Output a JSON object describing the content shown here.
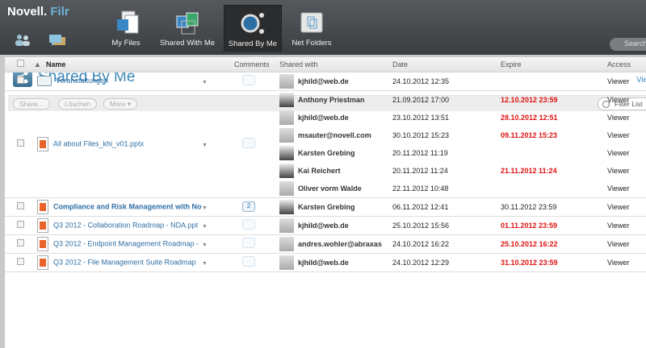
{
  "app": {
    "brand": "Novell.",
    "product": "Filr",
    "search_placeholder": "Search"
  },
  "nav": [
    {
      "label": "My Files",
      "icon": "my-files-icon"
    },
    {
      "label": "Shared With Me",
      "icon": "shared-with-me-icon"
    },
    {
      "label": "Shared By Me",
      "icon": "shared-by-me-icon",
      "active": true
    },
    {
      "label": "Net Folders",
      "icon": "net-folders-icon"
    }
  ],
  "page": {
    "title": "Shared By Me",
    "view_link": "Vie"
  },
  "toolbar": {
    "share": "Share...",
    "delete": "Löschen",
    "more": "More ▾",
    "filter": "Filter List"
  },
  "columns": {
    "name": "Name",
    "comments": "Comments",
    "shared_with": "Shared with",
    "date": "Date",
    "expire": "Expire",
    "access": "Access"
  },
  "rows": [
    {
      "name": "Veranstaltungen",
      "type": "folder",
      "comments": "",
      "shares": [
        {
          "who": "kjhild@web.de",
          "date": "24.10.2012 12:35",
          "expire": "",
          "expired": false,
          "access": "Viewer"
        }
      ]
    },
    {
      "name": "All about Files_khi_v01.pptx",
      "type": "pptx",
      "comments": "",
      "shares": [
        {
          "who": "Anthony Priestman",
          "date": "21.09.2012 17:00",
          "expire": "12.10.2012 23:59",
          "expired": true,
          "access": "Viewer"
        },
        {
          "who": "kjhild@web.de",
          "date": "23.10.2012 13:51",
          "expire": "28.10.2012 12:51",
          "expired": true,
          "access": "Viewer"
        },
        {
          "who": "msauter@novell.com",
          "date": "30.10.2012 15:23",
          "expire": "09.11.2012 15:23",
          "expired": true,
          "access": "Viewer"
        },
        {
          "who": "Karsten Grebing",
          "date": "20.11.2012 11:19",
          "expire": "",
          "expired": false,
          "access": "Viewer"
        },
        {
          "who": "Kai Reichert",
          "date": "20.11.2012 11:24",
          "expire": "21.11.2012 11:24",
          "expired": true,
          "access": "Viewer"
        },
        {
          "who": "Oliver vorm Walde",
          "date": "22.11.2012 10:48",
          "expire": "",
          "expired": false,
          "access": "Viewer"
        }
      ]
    },
    {
      "name": "Compliance and Risk Management with No",
      "type": "pptx",
      "unread": true,
      "comments": "2",
      "shares": [
        {
          "who": "Karsten Grebing",
          "date": "06.11.2012 12:41",
          "expire": "30.11.2012 23:59",
          "expired": false,
          "access": "Viewer"
        }
      ]
    },
    {
      "name": "Q3 2012 - Collaboration Roadmap - NDA.ppt",
      "type": "pptx",
      "comments": "",
      "shares": [
        {
          "who": "kjhild@web.de",
          "date": "25.10.2012 15:56",
          "expire": "01.11.2012 23:59",
          "expired": true,
          "access": "Viewer"
        }
      ]
    },
    {
      "name": "Q3 2012 - Endpoint Management Roadmap -",
      "type": "pptx",
      "comments": "",
      "shares": [
        {
          "who": "andres.wohler@abraxas",
          "date": "24.10.2012 16:22",
          "expire": "25.10.2012 16:22",
          "expired": true,
          "access": "Viewer"
        }
      ]
    },
    {
      "name": "Q3 2012 - File Management Suite Roadmap",
      "type": "pptx",
      "comments": "",
      "shares": [
        {
          "who": "kjhild@web.de",
          "date": "24.10.2012 12:29",
          "expire": "31.10.2012 23:59",
          "expired": true,
          "access": "Viewer"
        }
      ]
    }
  ]
}
